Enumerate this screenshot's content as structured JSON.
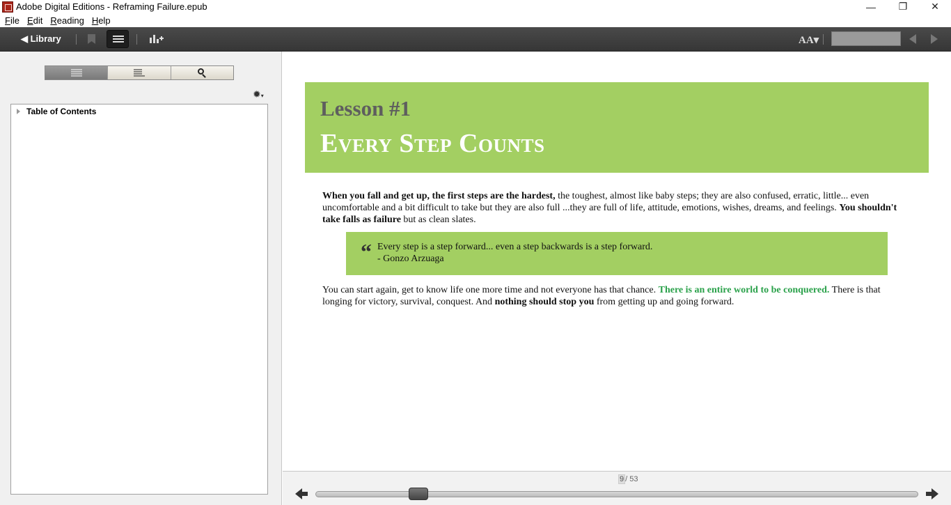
{
  "window": {
    "title": "Adobe Digital Editions - Reframing Failure.epub",
    "minimize": "—",
    "restore": "❐",
    "close": "✕"
  },
  "menu": [
    {
      "label": "File",
      "key": "F",
      "rest": "ile"
    },
    {
      "label": "Edit",
      "key": "E",
      "rest": "dit"
    },
    {
      "label": "Reading",
      "key": "R",
      "rest": "eading"
    },
    {
      "label": "Help",
      "key": "H",
      "rest": "elp"
    }
  ],
  "toolbar": {
    "library_label": "◀ Library",
    "font_size_label": "AA▾",
    "page_field_value": ""
  },
  "sidebar": {
    "tabs": [
      "table-of-contents",
      "bookmarks",
      "search"
    ],
    "active_tab": 0,
    "gear": "✹",
    "gear_caret": "▾",
    "toc_root": "Table of Contents"
  },
  "book": {
    "lesson": "Lesson #1",
    "chapter_title": "Every Step Counts",
    "para1": {
      "bold1": "When you fall and get up, the first steps are the hardest,",
      "text1": " the toughest, almost like baby steps; they are also confused, erratic, little... even uncomfortable and a bit difficult to take but they are also full ...they are full of life, attitude, emotions, wishes, dreams, and feelings. ",
      "bold2": "You shouldn't take falls as failure",
      "text2": " but as clean slates."
    },
    "quote": {
      "mark": "“",
      "line1": "Every step is a step forward... even a step backwards is a step forward.",
      "line2": "- Gonzo Arzuaga"
    },
    "para2": {
      "text1": "You can start again, get to know life one more time and not everyone has that chance. ",
      "green": "There is an entire world to be conquered.",
      "text2": " There is that longing for victory, survival, conquest. And ",
      "bold": "nothing should stop you",
      "text3": " from getting up and going forward."
    },
    "banner_color": "#a3cf62",
    "highlight_color": "#2aa14a"
  },
  "navigation": {
    "current_page": "9",
    "total_pages": "/ 53",
    "progress_fraction": 0.16
  }
}
